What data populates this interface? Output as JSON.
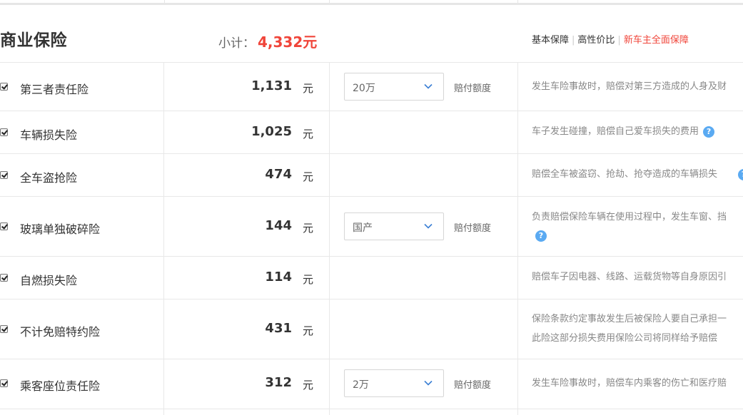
{
  "header": {
    "title": "商业保险",
    "subtotal_label": "小计：",
    "subtotal_value": "4,332元",
    "plans": [
      "基本保障",
      "高性价比",
      "新车主全面保障"
    ]
  },
  "colors": {
    "accent_red": "#f0453a",
    "help_blue": "#5aaaf2"
  },
  "items": [
    {
      "name": "第三者责任险",
      "price": "1,131",
      "unit": "元",
      "select": "20万",
      "field_label": "赔付额度",
      "desc": [
        "发生车险事故时，赔偿对第三方造成的人身及财"
      ],
      "checked": true
    },
    {
      "name": "车辆损失险",
      "price": "1,025",
      "unit": "元",
      "desc": [
        "车子发生碰撞，赔偿自己爱车损失的费用"
      ],
      "help": "?",
      "checked": true
    },
    {
      "name": "全车盗抢险",
      "price": "474",
      "unit": "元",
      "desc": [
        "赔偿全车被盗窃、抢劫、抢夺造成的车辆损失"
      ],
      "checked": true
    },
    {
      "name": "玻璃单独破碎险",
      "price": "144",
      "unit": "元",
      "select": "国产",
      "field_label": "赔付额度",
      "desc": [
        "负责赔偿保险车辆在使用过程中，发生车窗、挡"
      ],
      "help": "?",
      "checked": true
    },
    {
      "name": "自燃损失险",
      "price": "114",
      "unit": "元",
      "desc": [
        "赔偿车子因电器、线路、运载货物等自身原因引"
      ],
      "checked": true
    },
    {
      "name": "不计免赔特约险",
      "price": "431",
      "unit": "元",
      "desc": [
        "保险条款约定事故发生后被保险人要自己承担一",
        "此险这部分损失费用保险公司将同样给予赔偿"
      ],
      "checked": true
    },
    {
      "name": "乘客座位责任险",
      "price": "312",
      "unit": "元",
      "select": "2万",
      "field_label": "赔付额度",
      "desc": [
        "发生车险事故时，赔偿车内乘客的伤亡和医疗赔"
      ],
      "checked": true
    }
  ]
}
